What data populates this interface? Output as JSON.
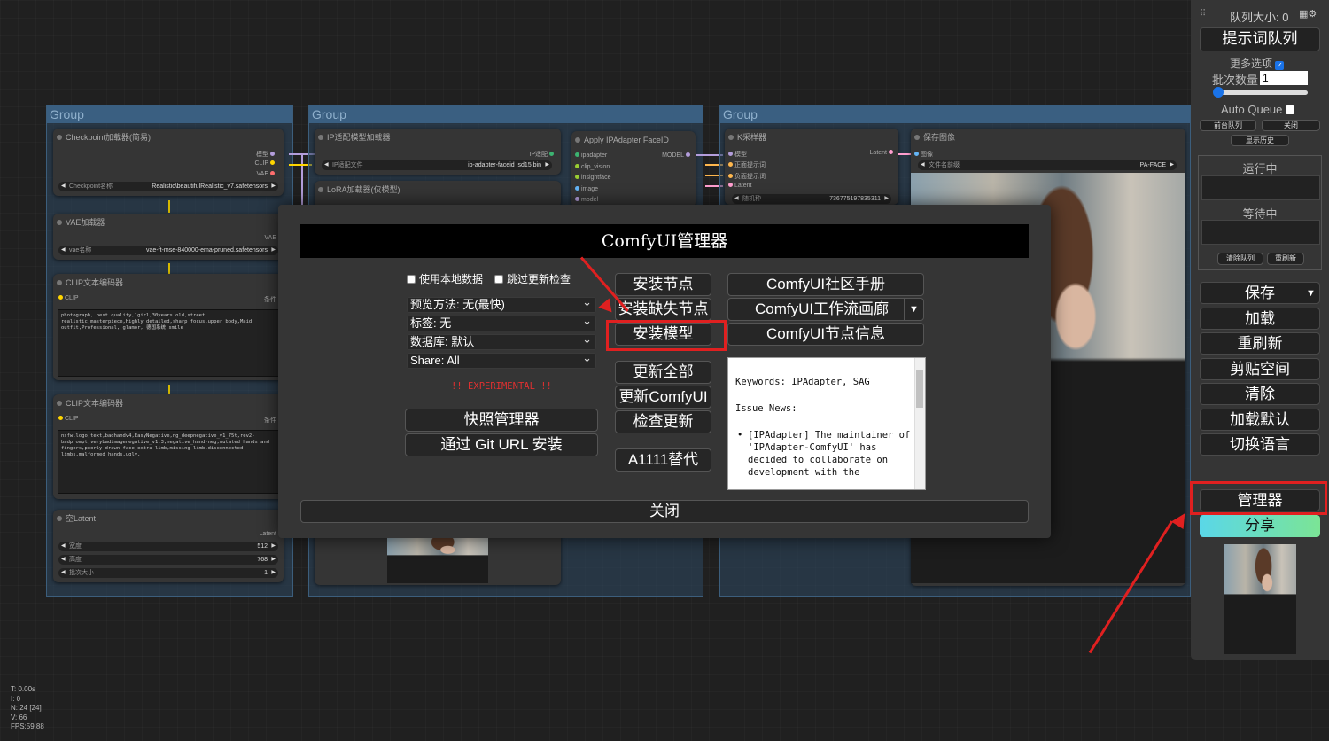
{
  "groups": [
    {
      "title": "Group"
    },
    {
      "title": "Group"
    },
    {
      "title": "Group"
    }
  ],
  "nodes": {
    "checkpoint": {
      "title": "Checkpoint加载器(简易)",
      "outputs": [
        "模型",
        "CLIP",
        "VAE"
      ],
      "widget_label": "Checkpoint名称",
      "widget_value": "Realistic\\beautifulRealistic_v7.safetensors"
    },
    "vae": {
      "title": "VAE加载器",
      "output": "VAE",
      "widget_label": "vae名称",
      "widget_value": "vae-ft-mse-840000-ema-pruned.safetensors"
    },
    "clip_pos": {
      "title": "CLIP文本编码器",
      "input": "CLIP",
      "output": "条件",
      "text": "photograph, best quality,1girl,30years old,street, realistic,masterpiece,Highly detailed,sharp focus,upper body,Maid outfit,Professional, glamor, 德国系统,smile"
    },
    "clip_neg": {
      "title": "CLIP文本编码器",
      "input": "CLIP",
      "output": "条件",
      "text": "nsfw,logo,text,badhandv4,EasyNegative,ng_deepnegative_v1_75t,rev2-badprompt,verybadimagenegative_v1.3,negative_hand-neg,mutated hands and fingers,poorly drawn face,extra limb,missing limb,disconnected limbs,malformed hands,ugly,"
    },
    "latent": {
      "title": "空Latent",
      "output": "Latent",
      "rows": [
        {
          "label": "宽度",
          "value": "512"
        },
        {
          "label": "高度",
          "value": "768"
        },
        {
          "label": "批次大小",
          "value": "1"
        }
      ]
    },
    "ip_model": {
      "title": "IP适配模型加载器",
      "output": "IP适配",
      "widget_label": "IP适配文件",
      "widget_value": "ip-adapter-faceid_sd15.bin"
    },
    "lora": {
      "title": "LoRA加载器(仅模型)"
    },
    "apply_ip": {
      "title": "Apply IPAdapter FaceID",
      "inputs": [
        "ipadapter",
        "clip_vision",
        "insightface",
        "image",
        "model"
      ],
      "output": "MODEL"
    },
    "ksampler": {
      "title": "K采样器",
      "inputs": [
        "模型",
        "正面提示词",
        "负面提示词",
        "Latent"
      ],
      "output": "Latent",
      "widget_label": "随机种",
      "widget_value": "736775197835311"
    },
    "save": {
      "title": "保存图像",
      "input": "图像",
      "widget_label": "文件名前缀",
      "widget_value": "IPA-FACE"
    }
  },
  "dialog": {
    "title": "ComfyUI管理器",
    "use_local_db": "使用本地数据",
    "skip_update_check": "跳过更新检查",
    "preview_method": "预览方法: 无(最快)",
    "tag": "标签: 无",
    "database": "数据库: 默认",
    "share": "Share: All",
    "experimental": "!! EXPERIMENTAL !!",
    "snapshot_manager": "快照管理器",
    "install_git_url": "通过 Git URL 安装",
    "install_nodes": "安装节点",
    "install_missing": "安装缺失节点",
    "install_models": "安装模型",
    "update_all": "更新全部",
    "update_comfyui": "更新ComfyUI",
    "check_update": "检查更新",
    "a1111": "A1111替代",
    "community_manual": "ComfyUI社区手册",
    "workflow_gallery": "ComfyUI工作流画廊",
    "node_info": "ComfyUI节点信息",
    "news_keywords": "Keywords: IPAdapter, SAG",
    "news_heading": "Issue News:",
    "news_item": "[IPAdapter] The maintainer of 'IPAdapter-ComfyUI' has decided to collaborate on development with the",
    "close": "关闭"
  },
  "panel": {
    "queue_size": "队列大小: 0",
    "queue_prompt": "提示词队列",
    "more_options": "更多选项",
    "batch_count_label": "批次数量",
    "batch_count_value": "1",
    "auto_queue": "Auto Queue",
    "front_queue": "前台队列",
    "close": "关闭",
    "show_history": "显示历史",
    "running": "运行中",
    "pending": "等待中",
    "clear_queue": "清除队列",
    "refresh": "重刷新",
    "save": "保存",
    "load": "加载",
    "refresh2": "重刷新",
    "clipspace": "剪贴空间",
    "clear": "清除",
    "load_default": "加载默认",
    "switch_lang": "切换语言",
    "manager": "管理器",
    "share": "分享"
  },
  "stats": {
    "t": "T: 0.00s",
    "i": "I: 0",
    "n": "N: 24 [24]",
    "v": "V: 66",
    "fps": "FPS:59.88"
  },
  "colors": {
    "accent_red": "#e02020",
    "link_yellow": "#d4b800",
    "group_title": "#3a5f81"
  }
}
